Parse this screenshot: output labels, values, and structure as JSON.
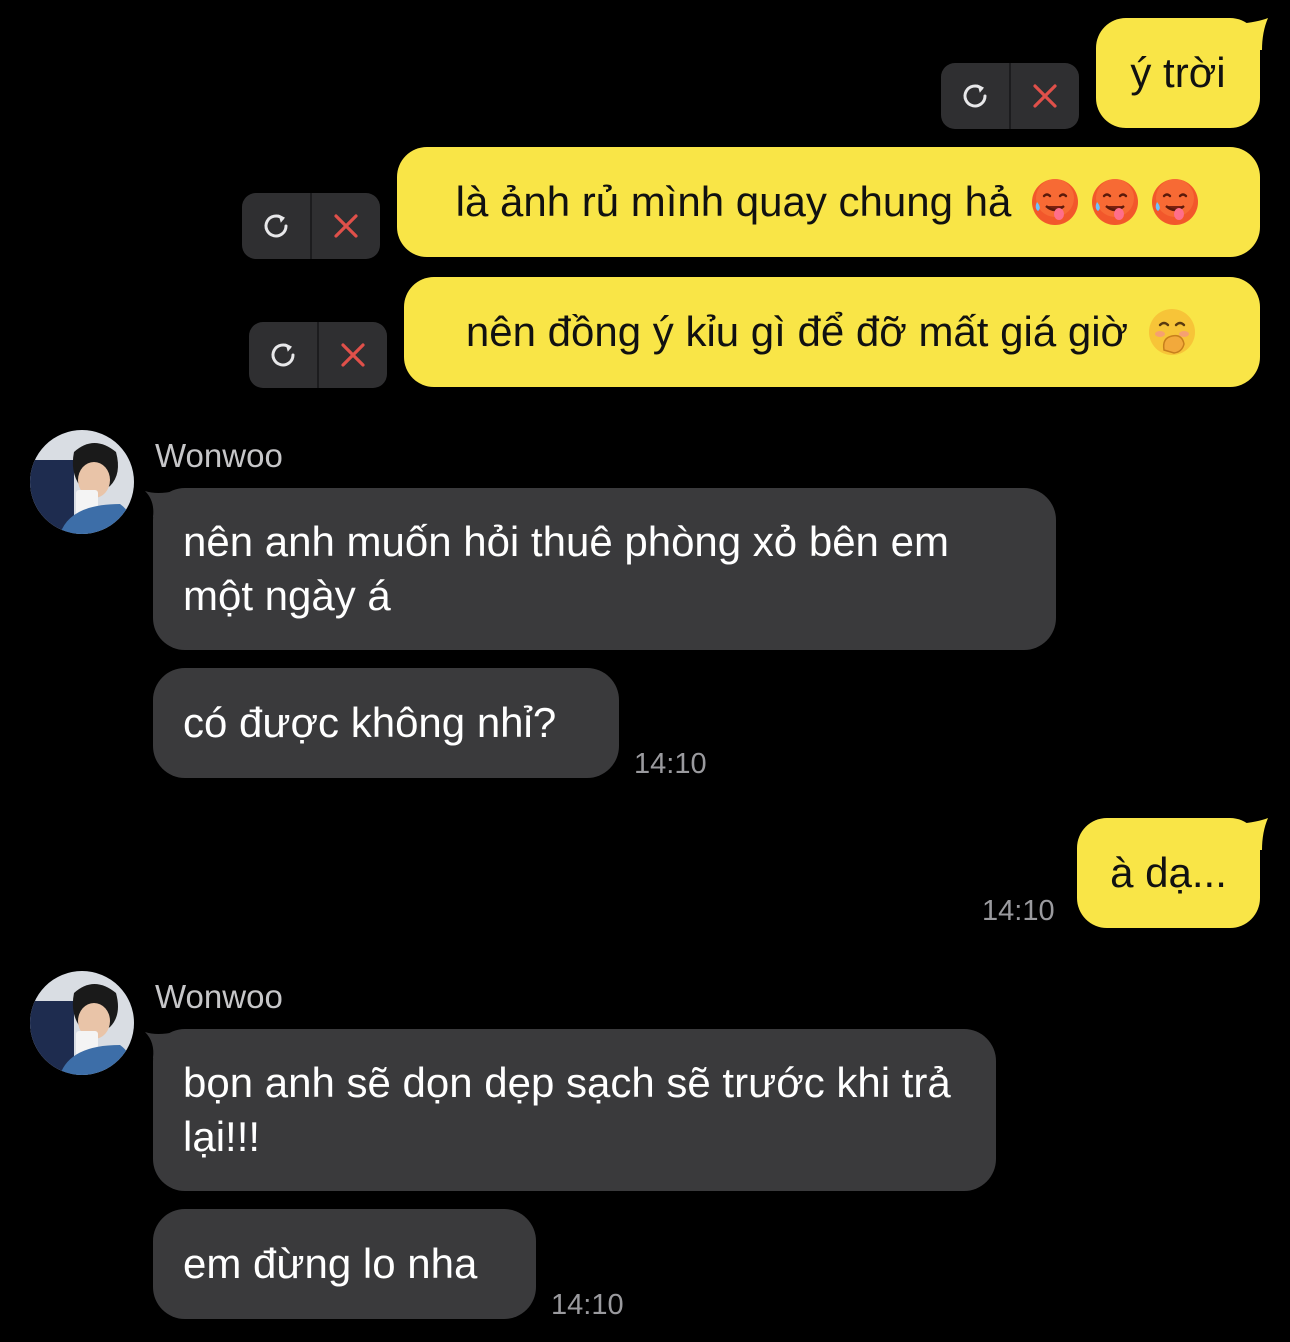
{
  "colors": {
    "background": "#000000",
    "outgoing_bubble": "#f9e547",
    "incoming_bubble": "#3a3a3c",
    "fail_pill": "#2f2f31",
    "delete_x": "#e0504a",
    "timestamp": "#9a9a9e"
  },
  "messages": [
    {
      "id": "m1",
      "direction": "outgoing",
      "text": "ý trời",
      "status": "failed"
    },
    {
      "id": "m2",
      "direction": "outgoing",
      "text": "là ảnh rủ mình quay chung hả",
      "emojis": [
        "hot-face-icon",
        "hot-face-icon",
        "hot-face-icon"
      ],
      "status": "failed"
    },
    {
      "id": "m3",
      "direction": "outgoing",
      "text": "nên đồng ý kỉu gì để đỡ mất giá giờ",
      "emojis": [
        "face-with-hand-over-mouth-icon"
      ],
      "status": "failed"
    },
    {
      "id": "m4",
      "direction": "incoming",
      "sender": "Wonwoo",
      "text": "nên anh muốn hỏi thuê phòng xỏ bên em một ngày á"
    },
    {
      "id": "m5",
      "direction": "incoming",
      "text": "có được không nhỉ?",
      "time": "14:10"
    },
    {
      "id": "m6",
      "direction": "outgoing",
      "text": "à dạ...",
      "time": "14:10"
    },
    {
      "id": "m7",
      "direction": "incoming",
      "sender": "Wonwoo",
      "text": "bọn anh sẽ dọn dẹp sạch sẽ trước khi trả lại!!!"
    },
    {
      "id": "m8",
      "direction": "incoming",
      "text": "em đừng lo nha",
      "time": "14:10"
    }
  ],
  "fail_actions": {
    "retry_icon": "retry-icon",
    "delete_icon": "close-icon"
  }
}
